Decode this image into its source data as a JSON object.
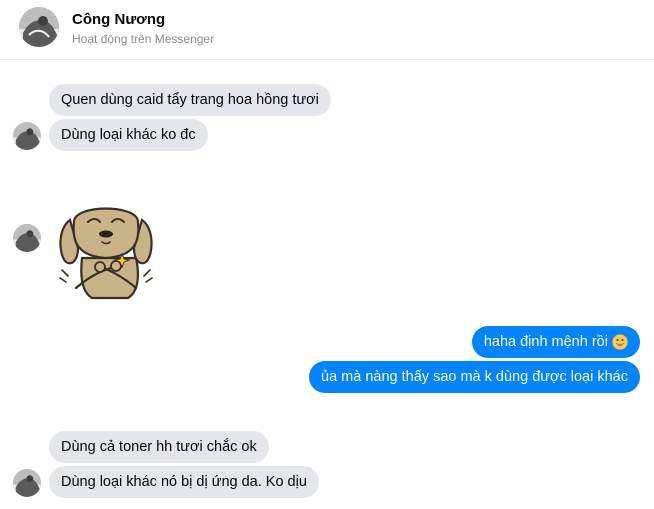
{
  "header": {
    "contact_name": "Công Nương",
    "status": "Hoạt động trên Messenger",
    "avatar_icon": "profile-photo-icon"
  },
  "messages": [
    {
      "side": "incoming",
      "text": "Quen dùng caid tẩy trang hoa hồng tươi"
    },
    {
      "side": "incoming",
      "text": "Dùng loại khác ko đc"
    },
    {
      "side": "incoming",
      "type": "sticker",
      "sticker": "puppy-hugging-self-sticker"
    },
    {
      "side": "outgoing",
      "text": "haha định mệnh rồi",
      "emoji": "grinning-face-icon"
    },
    {
      "side": "outgoing",
      "text": "ủa mà nàng thấy sao mà k dùng được loại khác"
    },
    {
      "side": "incoming",
      "text": "Dùng cả toner hh tươi chắc ok"
    },
    {
      "side": "incoming",
      "text": "Dùng loại khác nó bị dị ứng da. Ko dịu"
    }
  ],
  "colors": {
    "outgoing_bubble": "#0084ff",
    "incoming_bubble": "#e4e6eb",
    "status_text": "#8a8d91"
  }
}
